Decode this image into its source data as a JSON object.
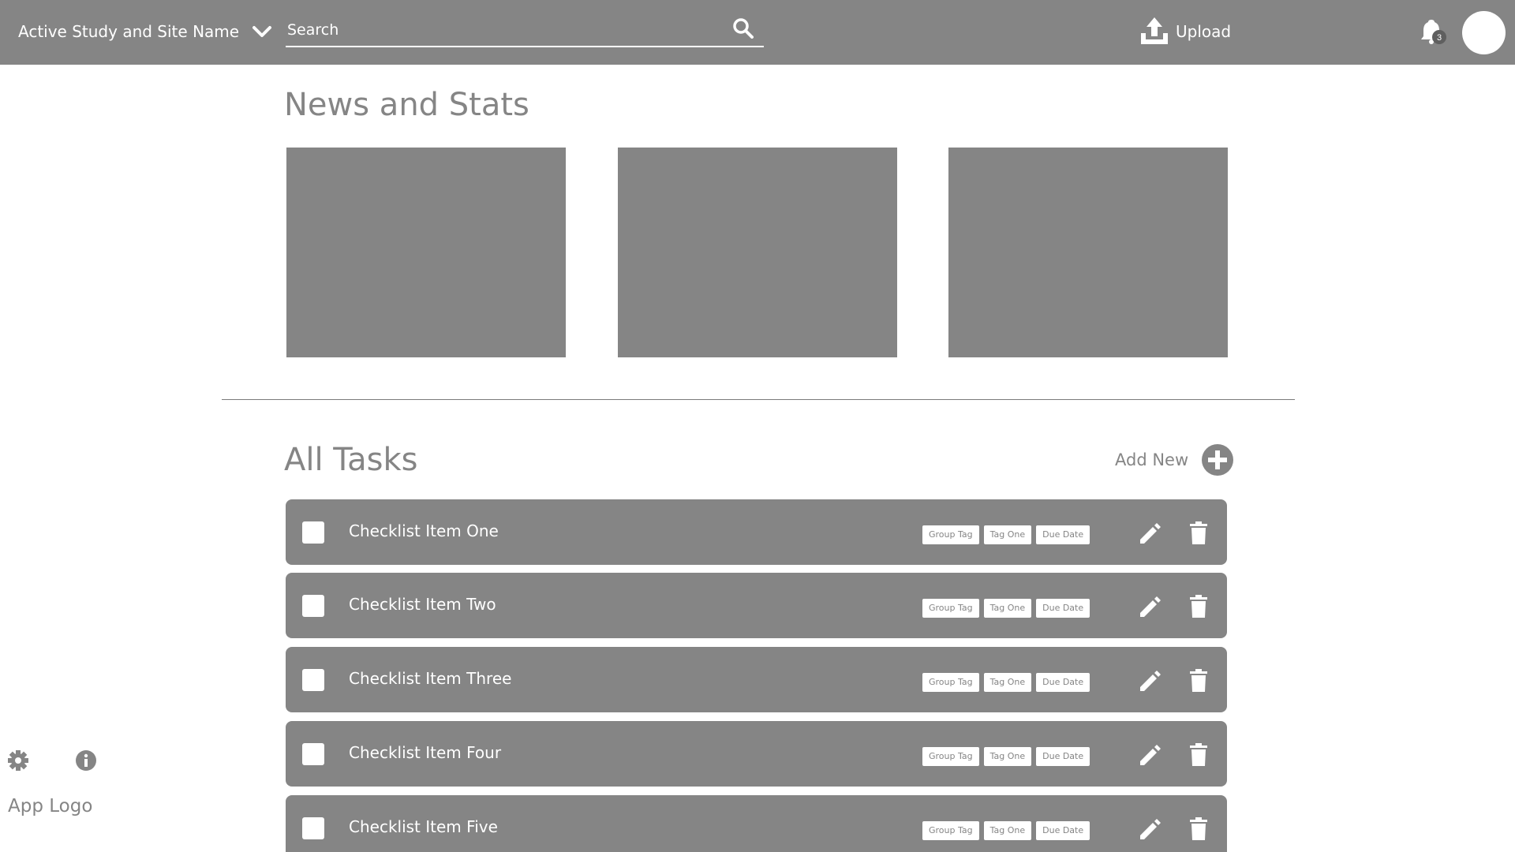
{
  "header": {
    "study_name": "Active Study and Site Name",
    "search_placeholder": "Search",
    "upload_label": "Upload",
    "notification_count": "3"
  },
  "news": {
    "title": "News and Stats"
  },
  "tasks": {
    "title": "All Tasks",
    "add_new_label": "Add New",
    "items": [
      {
        "label": "Checklist Item One",
        "tags": [
          "Group Tag",
          "Tag One",
          "Due Date"
        ]
      },
      {
        "label": "Checklist Item Two",
        "tags": [
          "Group Tag",
          "Tag One",
          "Due Date"
        ]
      },
      {
        "label": "Checklist Item Three",
        "tags": [
          "Group Tag",
          "Tag One",
          "Due Date"
        ]
      },
      {
        "label": "Checklist Item Four",
        "tags": [
          "Group Tag",
          "Tag One",
          "Due Date"
        ]
      },
      {
        "label": "Checklist Item Five",
        "tags": [
          "Group Tag",
          "Tag One",
          "Due Date"
        ]
      }
    ]
  },
  "sidebar": {
    "app_logo": "App Logo"
  },
  "colors": {
    "primary_gray": "#858585",
    "background": "#ffffff"
  },
  "icons": [
    "chevron-down-icon",
    "search-icon",
    "upload-icon",
    "bell-icon",
    "plus-circle-icon",
    "pencil-icon",
    "trash-icon",
    "gear-icon",
    "info-icon"
  ]
}
